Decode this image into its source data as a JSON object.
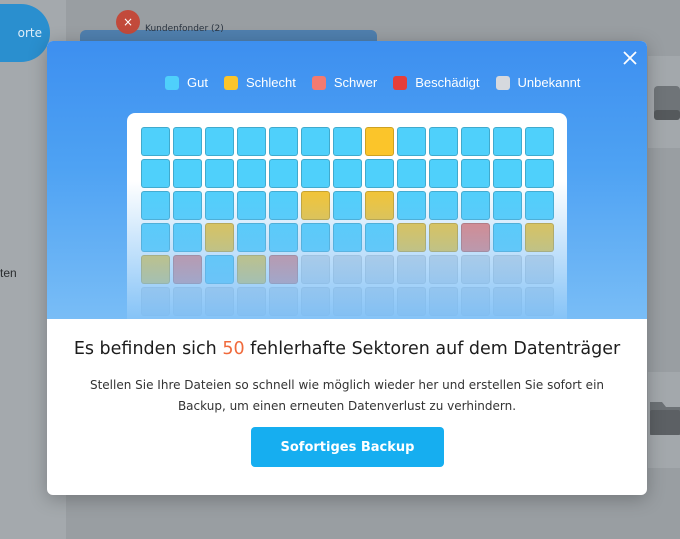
{
  "background": {
    "sidebar_button_fragment": "orte",
    "sidebar_text_fragment": "ten",
    "top_text_fragment": "Kundenfonder (2)"
  },
  "modal": {
    "legend": [
      {
        "label": "Gut",
        "color": "#4fd0fb",
        "status": "good"
      },
      {
        "label": "Schlecht",
        "color": "#fbc52a",
        "status": "bad"
      },
      {
        "label": "Schwer",
        "color": "#f27a70",
        "status": "severe"
      },
      {
        "label": "Beschädigt",
        "color": "#e63e3a",
        "status": "damaged"
      },
      {
        "label": "Unbekannt",
        "color": "#d6d9de",
        "status": "unknown"
      }
    ],
    "sector_grid": {
      "columns": 13,
      "rows": [
        [
          "good",
          "good",
          "good",
          "good",
          "good",
          "good",
          "good",
          "bad",
          "good",
          "good",
          "good",
          "good",
          "good"
        ],
        [
          "good",
          "good",
          "good",
          "good",
          "good",
          "good",
          "good",
          "good",
          "good",
          "good",
          "good",
          "good",
          "good"
        ],
        [
          "good",
          "good",
          "good",
          "good",
          "good",
          "bad",
          "good",
          "bad",
          "good",
          "good",
          "good",
          "good",
          "good"
        ],
        [
          "good",
          "good",
          "bad",
          "good",
          "good",
          "good",
          "good",
          "good",
          "bad",
          "bad",
          "severe",
          "good",
          "bad"
        ],
        [
          "bad",
          "severe",
          "good",
          "bad",
          "severe",
          "unknown",
          "unknown",
          "unknown",
          "unknown",
          "unknown",
          "unknown",
          "unknown",
          "unknown"
        ],
        [
          "unknown",
          "unknown",
          "unknown",
          "unknown",
          "unknown",
          "unknown",
          "unknown",
          "unknown",
          "unknown",
          "unknown",
          "unknown",
          "unknown",
          "unknown"
        ]
      ]
    },
    "headline_prefix": "Es befinden sich ",
    "bad_sector_count": "50",
    "headline_suffix": " fehlerhafte Sektoren auf dem Datenträger",
    "subtext": "Stellen Sie Ihre Dateien so schnell wie möglich wieder her und erstellen Sie sofort ein Backup, um einen erneuten Datenverlust zu verhindern.",
    "primary_button_label": "Sofortiges Backup",
    "close_icon": "close-icon"
  }
}
